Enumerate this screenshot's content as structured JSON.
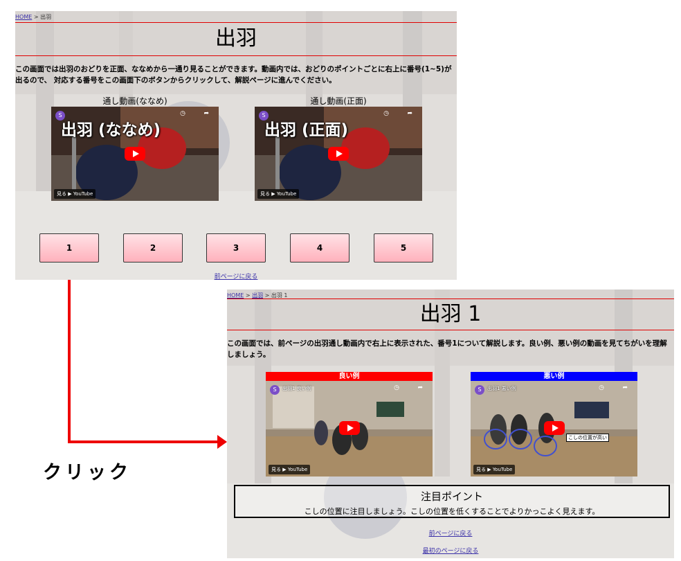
{
  "top": {
    "breadcrumb": {
      "home": "HOME",
      "sep1": " > ",
      "current": "出羽"
    },
    "title": "出羽",
    "description": "この画面では出羽のおどりを正面、ななめから一通り見ることができます。動画内では、おどりのポイントごとに右上に番号(1~5)が出るので、 対応する番号をこの画面下のボタンからクリックして、解説ページに進んでください。",
    "videos": [
      {
        "label": "通し動画(ななめ)",
        "overlay": "出羽 (ななめ)",
        "avatar": "S",
        "watch": "見る ▶ YouTube"
      },
      {
        "label": "通し動画(正面)",
        "overlay": "出羽 (正面)",
        "avatar": "S",
        "watch": "見る ▶ YouTube"
      }
    ],
    "buttons": [
      "1",
      "2",
      "3",
      "4",
      "5"
    ],
    "back_link": "前ページに戻る"
  },
  "bottom": {
    "breadcrumb": {
      "home": "HOME",
      "sep1": " > ",
      "mid": "出羽",
      "sep2": " > ",
      "current": "出羽 1"
    },
    "title": "出羽 1",
    "description": "この画面では、前ページの出羽通し動画内で右上に表示された、番号1について解説します。良い例、悪い例の動画を見てちがいを理解しましょう。",
    "good": {
      "header": "良い例",
      "small": "出羽1 良い例",
      "avatar": "S",
      "watch": "見る ▶ YouTube",
      "color": "#ff0000"
    },
    "bad": {
      "header": "悪い例",
      "small": "出羽1 悪い例",
      "avatar": "S",
      "watch": "見る ▶ YouTube",
      "tag": "こしの位置が高い",
      "color": "#0000ff"
    },
    "point": {
      "heading": "注目ポイント",
      "text": "こしの位置に注目しましょう。こしの位置を低くすることでよりかっこよく見えます。"
    },
    "back_link": "前ページに戻る",
    "first_link": "最初のページに戻る"
  },
  "annotation": {
    "click_label": "クリック",
    "arrow_color": "#ee0000"
  }
}
